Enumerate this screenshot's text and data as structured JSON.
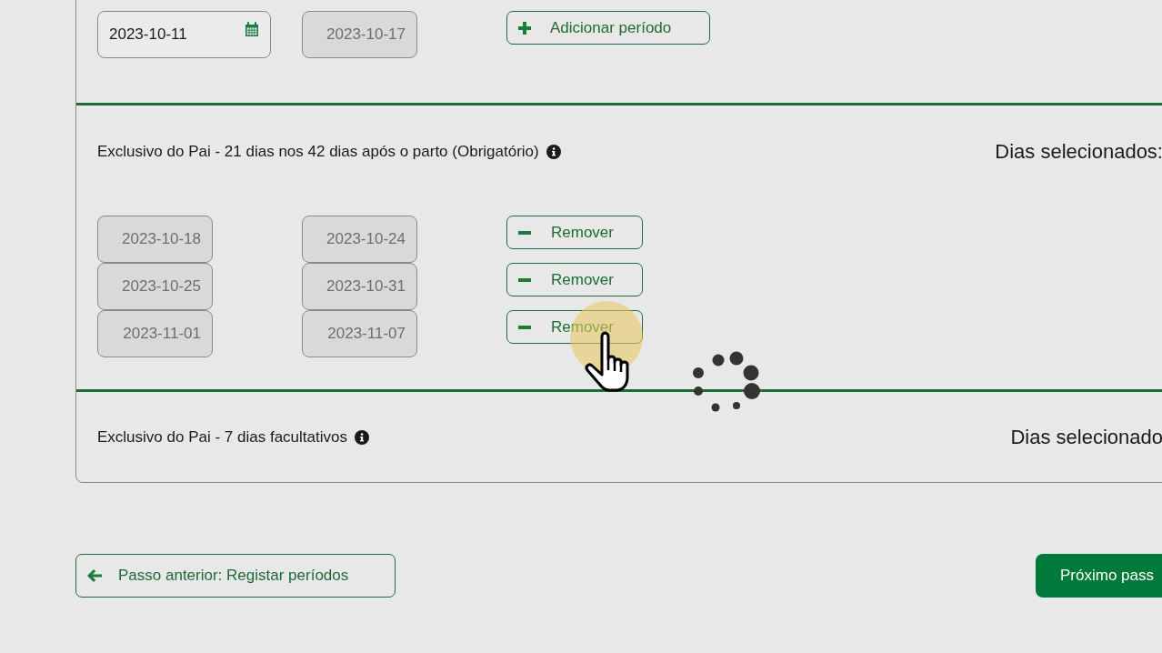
{
  "sections": [
    {
      "periods": [
        {
          "start": {
            "value": "2023-10-11",
            "disabled": false
          },
          "end": {
            "value": "2023-10-17",
            "disabled": true
          },
          "action": {
            "kind": "add",
            "label": "Adicionar período"
          }
        }
      ]
    },
    {
      "title": "Exclusivo do Pai - 21 dias nos 42 dias após o parto (Obrigatório)",
      "selected_days": "Dias selecionados:",
      "periods": [
        {
          "start": {
            "value": "2023-10-18",
            "disabled": true
          },
          "end": {
            "value": "2023-10-24",
            "disabled": true
          },
          "action": {
            "kind": "remove",
            "label": "Remover"
          }
        },
        {
          "start": {
            "value": "2023-10-25",
            "disabled": true
          },
          "end": {
            "value": "2023-10-31",
            "disabled": true
          },
          "action": {
            "kind": "remove",
            "label": "Remover"
          }
        },
        {
          "start": {
            "value": "2023-11-01",
            "disabled": true
          },
          "end": {
            "value": "2023-11-07",
            "disabled": true
          },
          "action": {
            "kind": "remove",
            "label": "Remover"
          }
        }
      ]
    },
    {
      "title": "Exclusivo do Pai - 7 dias facultativos",
      "selected_days": "Dias selecionado"
    }
  ],
  "footer": {
    "back": "Passo anterior: Registar períodos",
    "next": "Próximo pass"
  }
}
